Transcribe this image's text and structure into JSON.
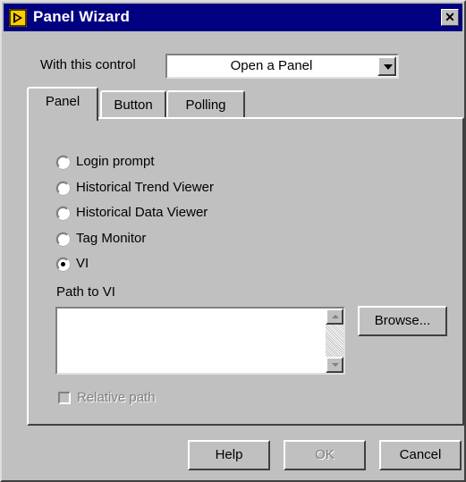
{
  "window": {
    "title": "Panel Wizard",
    "close_glyph": "✕"
  },
  "control_row": {
    "label": "With this control",
    "selected": "Open a Panel"
  },
  "tabs": [
    {
      "label": "Panel",
      "active": true
    },
    {
      "label": "Button",
      "active": false
    },
    {
      "label": "Polling",
      "active": false
    }
  ],
  "panel": {
    "radios": [
      {
        "label": "Login prompt",
        "checked": false
      },
      {
        "label": "Historical Trend Viewer",
        "checked": false
      },
      {
        "label": "Historical Data Viewer",
        "checked": false
      },
      {
        "label": "Tag Monitor",
        "checked": false
      },
      {
        "label": "VI",
        "checked": true
      }
    ],
    "path_label": "Path to VI",
    "path_value": "",
    "browse_label": "Browse...",
    "relative_path_label": "Relative path",
    "relative_path_checked": false
  },
  "footer": {
    "help_label": "Help",
    "ok_label": "OK",
    "cancel_label": "Cancel"
  },
  "colors": {
    "title_bar": "#000080",
    "face": "#c0c0c0"
  },
  "icons": {
    "app": "labview-panel-icon",
    "close": "close-icon",
    "dropdown": "chevron-down-icon"
  }
}
